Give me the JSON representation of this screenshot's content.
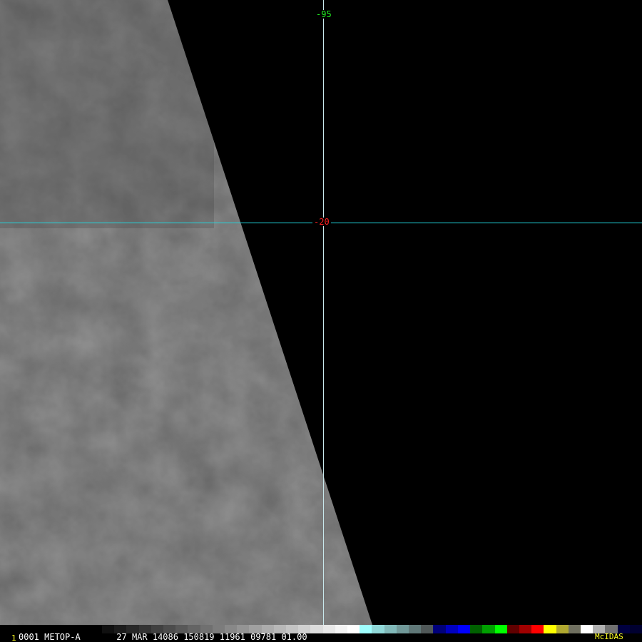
{
  "image": {
    "grid_labels": {
      "longitude": "-95",
      "latitude": "-20"
    },
    "colors": {
      "longitude_label": "#22ee22",
      "latitude_label": "#ff2020",
      "latitude_line": "#22d8e0",
      "swath": "#5c5c5c"
    }
  },
  "footer": {
    "frame_number": "1",
    "info": "0001 METOP-A       27 MAR 14086 150819 11961 09781 01.00",
    "brand": "McIDAS"
  },
  "colorbar": [
    "#101010",
    "#1c1c1c",
    "#282828",
    "#343434",
    "#404040",
    "#4c4c4c",
    "#585858",
    "#646464",
    "#707070",
    "#7c7c7c",
    "#888888",
    "#949494",
    "#a0a0a0",
    "#acacac",
    "#b8b8b8",
    "#c4c4c4",
    "#d0d0d0",
    "#dcdcdc",
    "#e8e8e8",
    "#f4f4f4",
    "#ffffff",
    "#a0ffff",
    "#90d8d8",
    "#80b8b8",
    "#709898",
    "#607878",
    "#505858",
    "#00007a",
    "#0000c0",
    "#0000ff",
    "#006000",
    "#00a000",
    "#00ff00",
    "#600000",
    "#a00000",
    "#ff0000",
    "#ffff00",
    "#b0a830",
    "#707060",
    "#ffffff",
    "#b0b0b0",
    "#707070",
    "#000040",
    "#000030"
  ]
}
